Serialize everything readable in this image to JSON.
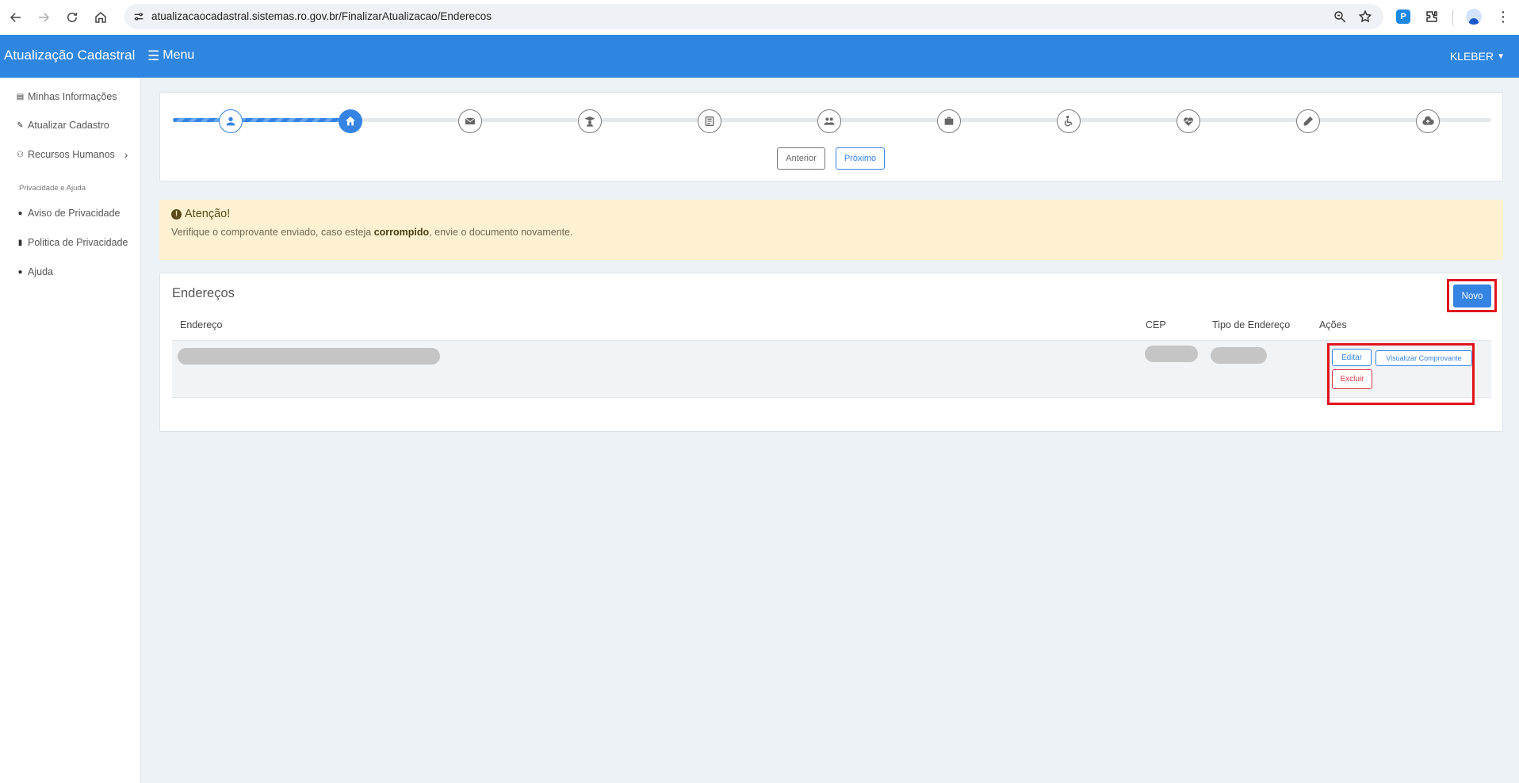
{
  "browser": {
    "url": "atualizacaocadastral.sistemas.ro.gov.br/FinalizarAtualizacao/Enderecos"
  },
  "header": {
    "brand": "Atualização Cadastral",
    "menu_label": "Menu",
    "user_label": "KLEBER"
  },
  "sidebar": {
    "items": [
      {
        "label": "Minhas Informações",
        "icon": "id-card-icon"
      },
      {
        "label": "Atualizar Cadastro",
        "icon": "user-edit-icon"
      },
      {
        "label": "Recursos Humanos",
        "icon": "users-icon"
      }
    ],
    "section_title": "Privacidade e Ajuda",
    "privacy_items": [
      {
        "label": "Aviso de Privacidade",
        "icon": "info-circle-icon"
      },
      {
        "label": "Politica de Privacidade",
        "icon": "file-icon"
      },
      {
        "label": "Ajuda",
        "icon": "question-circle-icon"
      }
    ]
  },
  "stepper": {
    "current_step": 2,
    "total_steps": 11,
    "steps": [
      "user",
      "home",
      "envelope",
      "graduate",
      "document",
      "family",
      "briefcase",
      "accessibility",
      "health",
      "pen",
      "cloud-upload"
    ],
    "prev_label": "Anterior",
    "next_label": "Próximo"
  },
  "alert": {
    "title": "Atenção!",
    "text_before": "Verifique o comprovante enviado, caso esteja ",
    "text_bold": "corrompido",
    "text_after": ", envie o documento novamente."
  },
  "addresses": {
    "title": "Endereços",
    "new_label": "Novo",
    "columns": [
      "Endereço",
      "CEP",
      "Tipo de Endereço",
      "Ações"
    ],
    "rows": [
      {
        "endereco": "",
        "cep": "",
        "tipo": "",
        "actions": {
          "edit": "Editar",
          "view": "Visualizar Comprovante",
          "delete": "Excluir"
        }
      }
    ]
  },
  "colors": {
    "primary": "#2f86e0",
    "alert_bg": "#fdf1d1",
    "danger": "#dc3545",
    "highlight": "#e0141e"
  }
}
